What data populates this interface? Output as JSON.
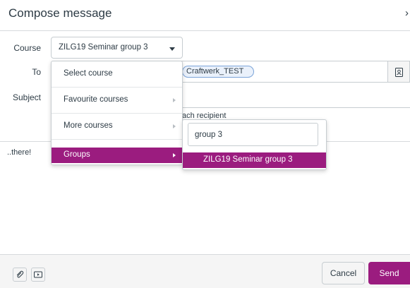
{
  "dialog": {
    "title": "Compose message",
    "close_glyph": "›"
  },
  "form": {
    "course_label": "Course",
    "course_value": "ZILG19 Seminar group 3",
    "to_label": "To",
    "to_recipient": "Craftwerk_TEST",
    "subject_label": "Subject",
    "each_recipient_text": "ach recipient",
    "body_text": "..there!"
  },
  "course_menu": {
    "items": [
      {
        "label": "Select course",
        "has_submenu": false,
        "active": false
      },
      {
        "label": "Favourite courses",
        "has_submenu": true,
        "active": false
      },
      {
        "label": "More courses",
        "has_submenu": true,
        "active": false
      },
      {
        "label": "Groups",
        "has_submenu": true,
        "active": true
      }
    ]
  },
  "groups_submenu": {
    "search_value": "group 3",
    "results": [
      "ZILG19 Seminar group 3"
    ]
  },
  "footer": {
    "cancel_label": "Cancel",
    "send_label": "Send",
    "icons": [
      "attach-icon",
      "media-icon"
    ]
  },
  "colors": {
    "accent": "#9b1c7f",
    "text": "#2d3b45",
    "border": "#c7cdd1"
  }
}
